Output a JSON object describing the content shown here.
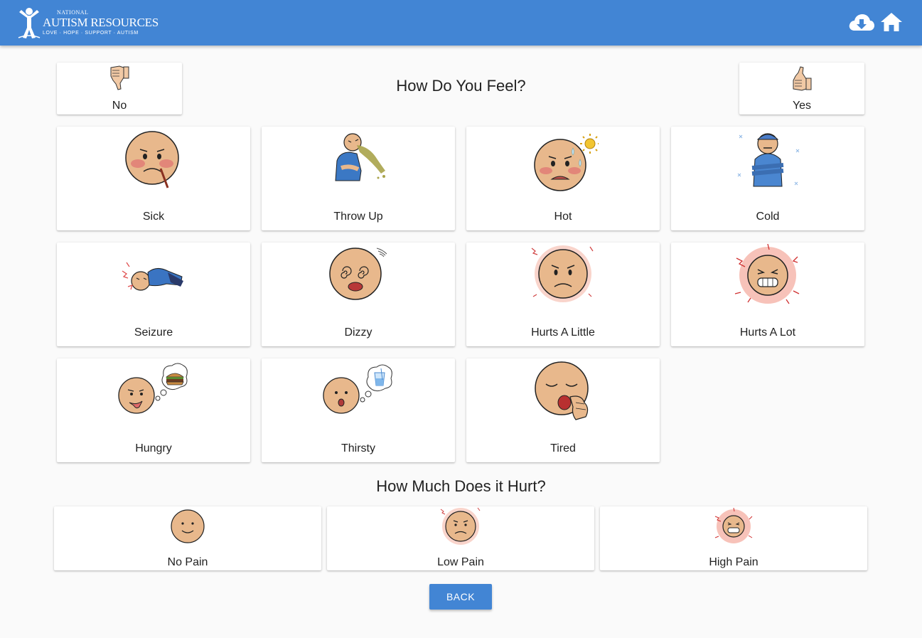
{
  "brand": {
    "logo_small": "NATIONAL",
    "logo_name": "AUTISM RESOURCES",
    "logo_tagline": "LOVE · HOPE · SUPPORT · AUTISM",
    "color": "#4285d4"
  },
  "header": {
    "icons": [
      "cloud-download-icon",
      "home-icon"
    ]
  },
  "feel_section": {
    "title": "How Do You Feel?",
    "no_label": "No",
    "yes_label": "Yes",
    "items": [
      {
        "label": "Sick",
        "icon": "sick-face-icon"
      },
      {
        "label": "Throw Up",
        "icon": "throw-up-icon"
      },
      {
        "label": "Hot",
        "icon": "hot-face-icon"
      },
      {
        "label": "Cold",
        "icon": "cold-person-icon"
      },
      {
        "label": "Seizure",
        "icon": "seizure-icon"
      },
      {
        "label": "Dizzy",
        "icon": "dizzy-face-icon"
      },
      {
        "label": "Hurts A Little",
        "icon": "hurts-little-icon"
      },
      {
        "label": "Hurts A Lot",
        "icon": "hurts-lot-icon"
      },
      {
        "label": "Hungry",
        "icon": "hungry-icon"
      },
      {
        "label": "Thirsty",
        "icon": "thirsty-icon"
      },
      {
        "label": "Tired",
        "icon": "tired-icon"
      }
    ]
  },
  "pain_section": {
    "title": "How Much Does it Hurt?",
    "items": [
      {
        "label": "No Pain",
        "icon": "no-pain-icon"
      },
      {
        "label": "Low Pain",
        "icon": "low-pain-icon"
      },
      {
        "label": "High Pain",
        "icon": "high-pain-icon"
      }
    ]
  },
  "back_button": "BACK"
}
